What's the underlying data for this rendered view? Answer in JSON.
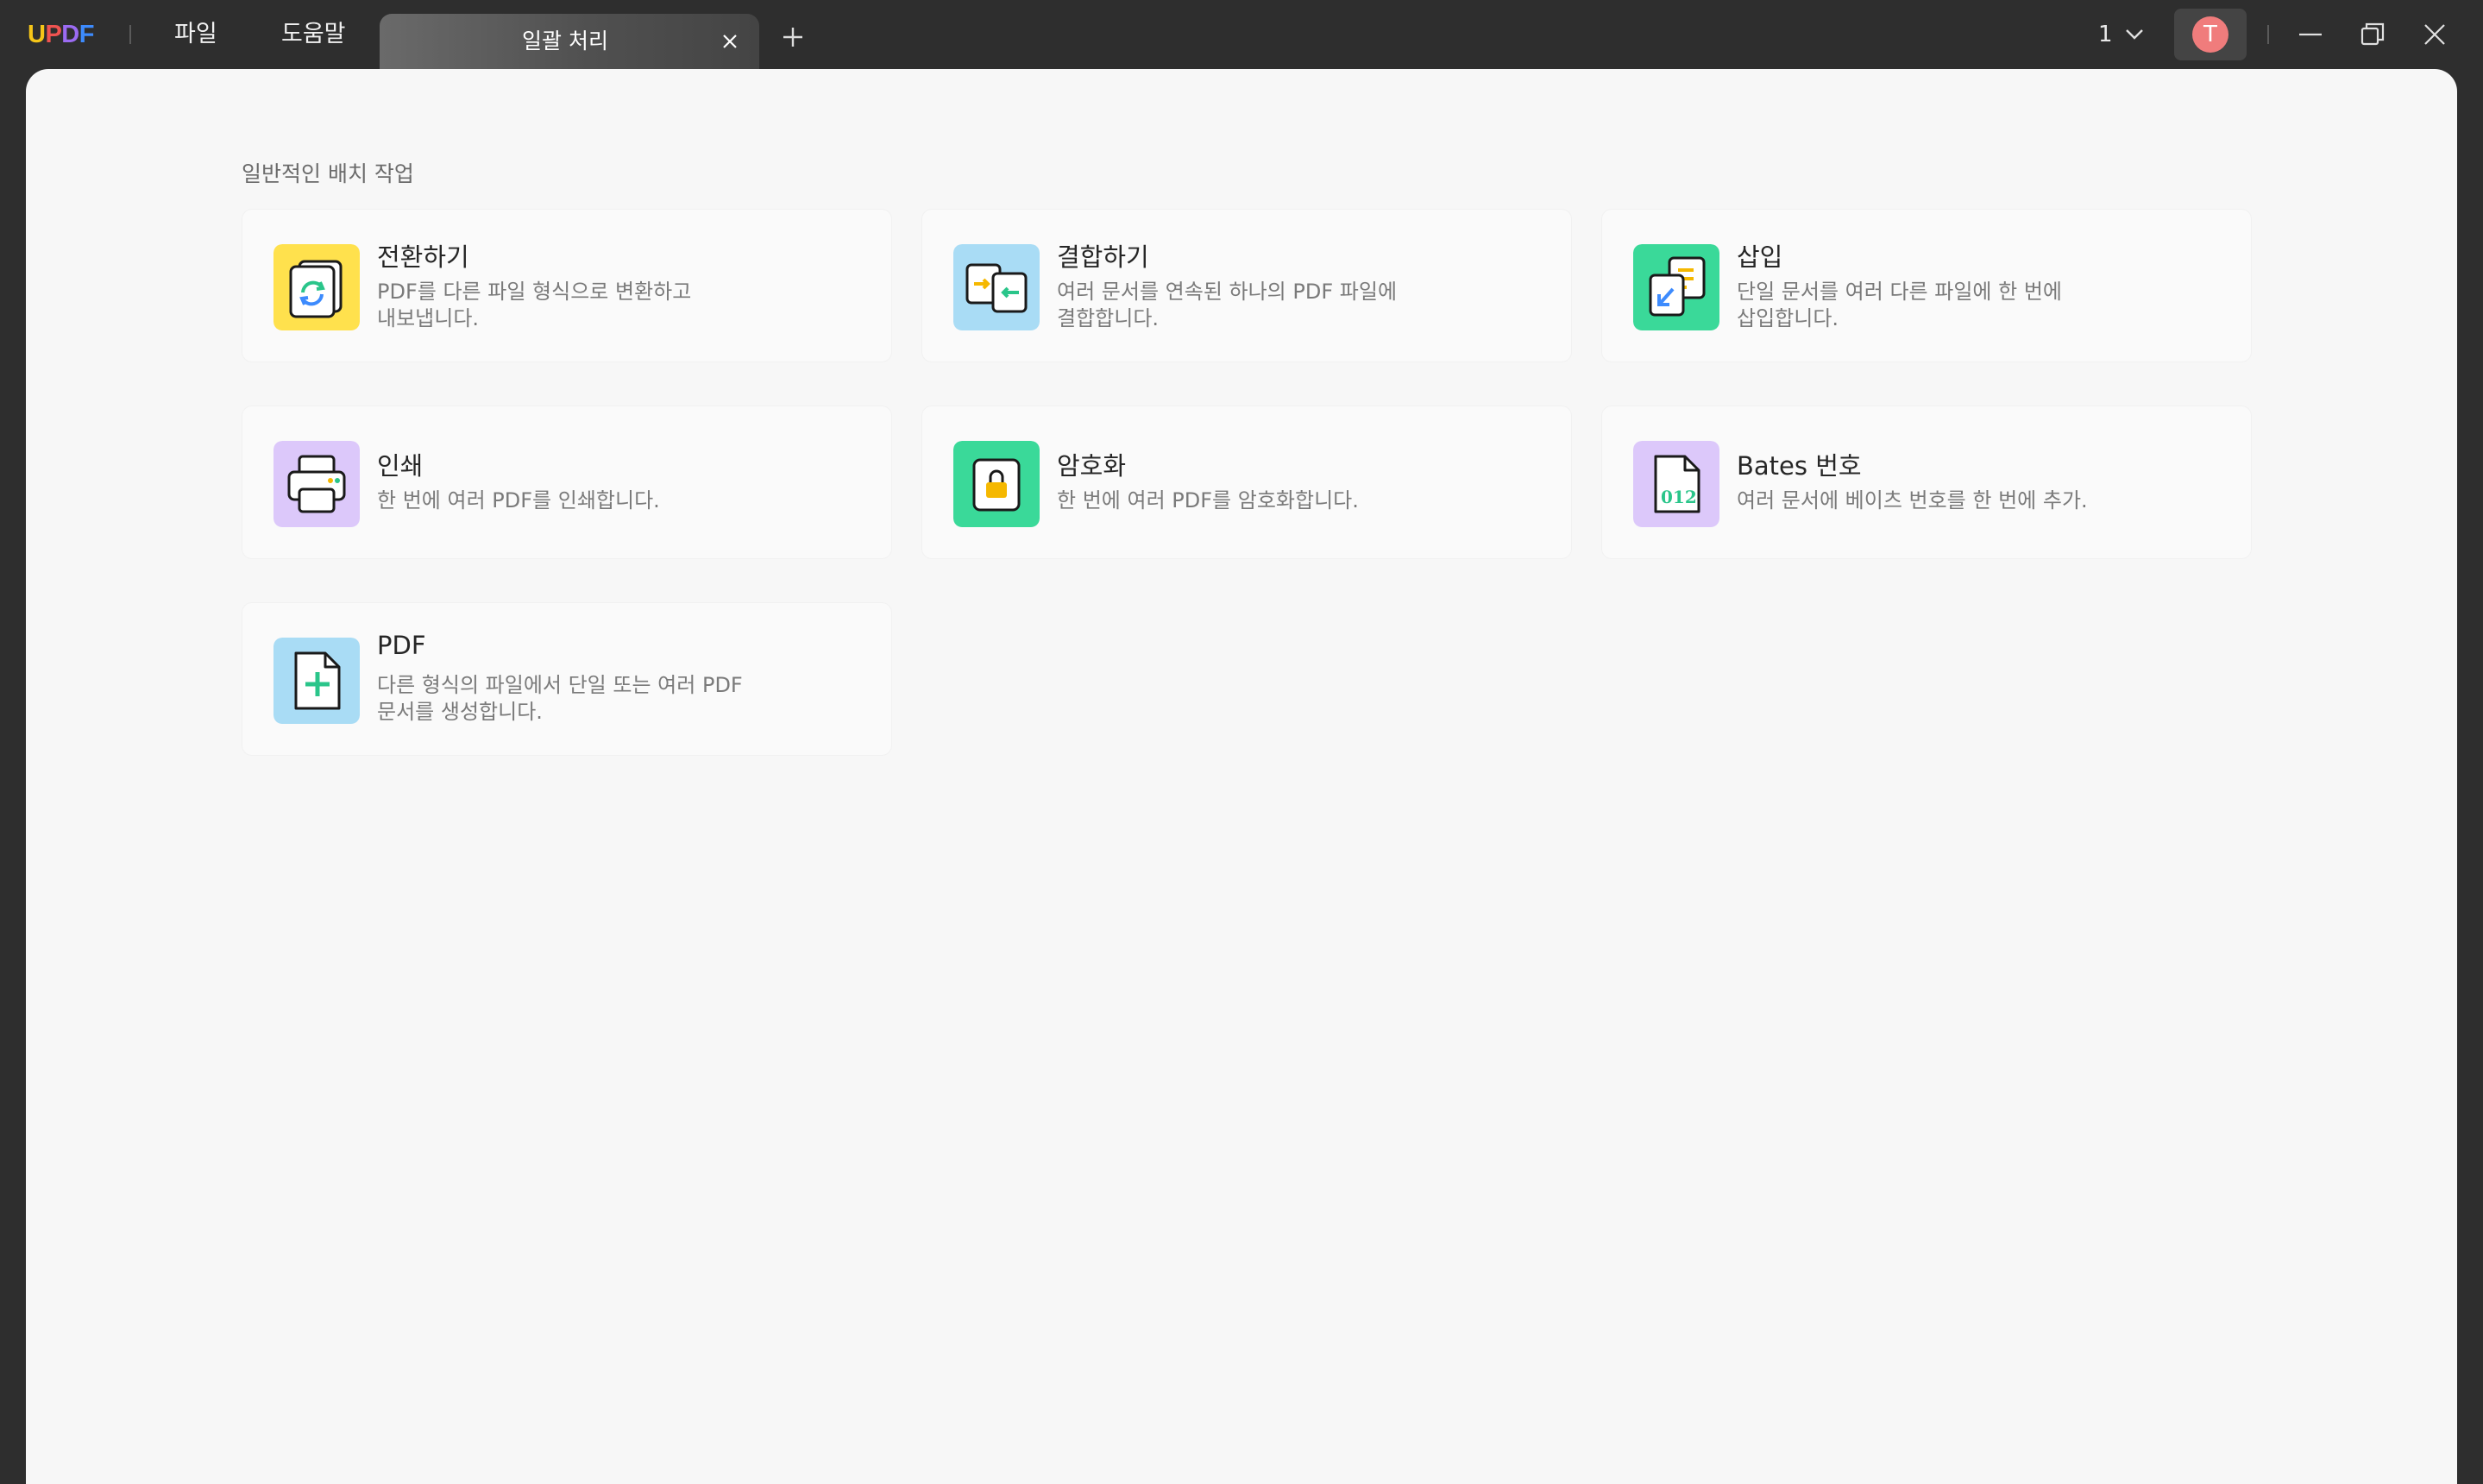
{
  "app": {
    "logo": [
      "U",
      "P",
      "D",
      "F"
    ],
    "menu": {
      "file": "파일",
      "help": "도움말"
    },
    "tab": {
      "label": "일괄 처리"
    },
    "page_number": "1",
    "avatar_initial": "T",
    "colors": {
      "accent_green": "#3ad999",
      "accent_yellow": "#ffd84d",
      "avatar": "#f07c7c"
    }
  },
  "main": {
    "section_title": "일반적인 배치 작업",
    "cards": [
      {
        "title": "전환하기",
        "desc1": "PDF를 다른 파일 형식으로 변환하고",
        "desc2": "내보냅니다.",
        "icon": "convert-icon"
      },
      {
        "title": "결합하기",
        "desc1": "여러 문서를 연속된 하나의 PDF 파일에",
        "desc2": "결합합니다.",
        "icon": "combine-icon"
      },
      {
        "title": "삽입",
        "desc1": "단일 문서를 여러 다른 파일에 한 번에",
        "desc2": "삽입합니다.",
        "icon": "insert-icon"
      },
      {
        "title": "인쇄",
        "desc1": "한 번에 여러 PDF를 인쇄합니다.",
        "desc2": "",
        "icon": "print-icon"
      },
      {
        "title": "암호화",
        "desc1": "한 번에 여러 PDF를 암호화합니다.",
        "desc2": "",
        "icon": "encrypt-icon"
      },
      {
        "title": "Bates 번호",
        "desc1": "여러 문서에 베이츠 번호를 한 번에 추가.",
        "desc2": "",
        "icon": "bates-number-icon",
        "icon_text": "012"
      },
      {
        "title": "PDF",
        "desc1": "다른 형식의 파일에서 단일 또는 여러 PDF",
        "desc2": "문서를 생성합니다.",
        "icon": "create-pdf-icon"
      }
    ]
  }
}
